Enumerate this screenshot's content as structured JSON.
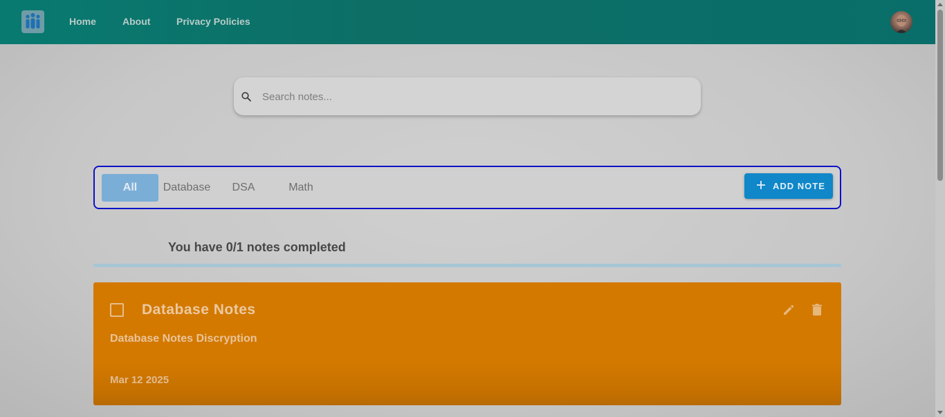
{
  "navbar": {
    "logo_icon": "people-logo-icon",
    "links": [
      "Home",
      "About",
      "Privacy Policies"
    ],
    "avatar_icon": "user-avatar"
  },
  "search": {
    "placeholder": "Search notes...",
    "value": "",
    "icon": "search-icon"
  },
  "filters": {
    "tabs": [
      "All",
      "Database",
      "DSA",
      "Math"
    ],
    "selected": "All",
    "add_button_label": "ADD NOTE",
    "add_button_icon": "plus-icon"
  },
  "progress": {
    "text": "You have 0/1 notes completed",
    "completed": 0,
    "total": 1
  },
  "notes": [
    {
      "title": "Database Notes",
      "description": "Database Notes Discryption",
      "date": "Mar 12 2025",
      "completed": false,
      "color": "#d37900"
    }
  ],
  "colors": {
    "navbar": "#0d6e66",
    "accent_blue": "#0f87c9",
    "active_tab": "#7baed7",
    "filter_border": "#0d10c7",
    "note_card": "#d37900"
  }
}
